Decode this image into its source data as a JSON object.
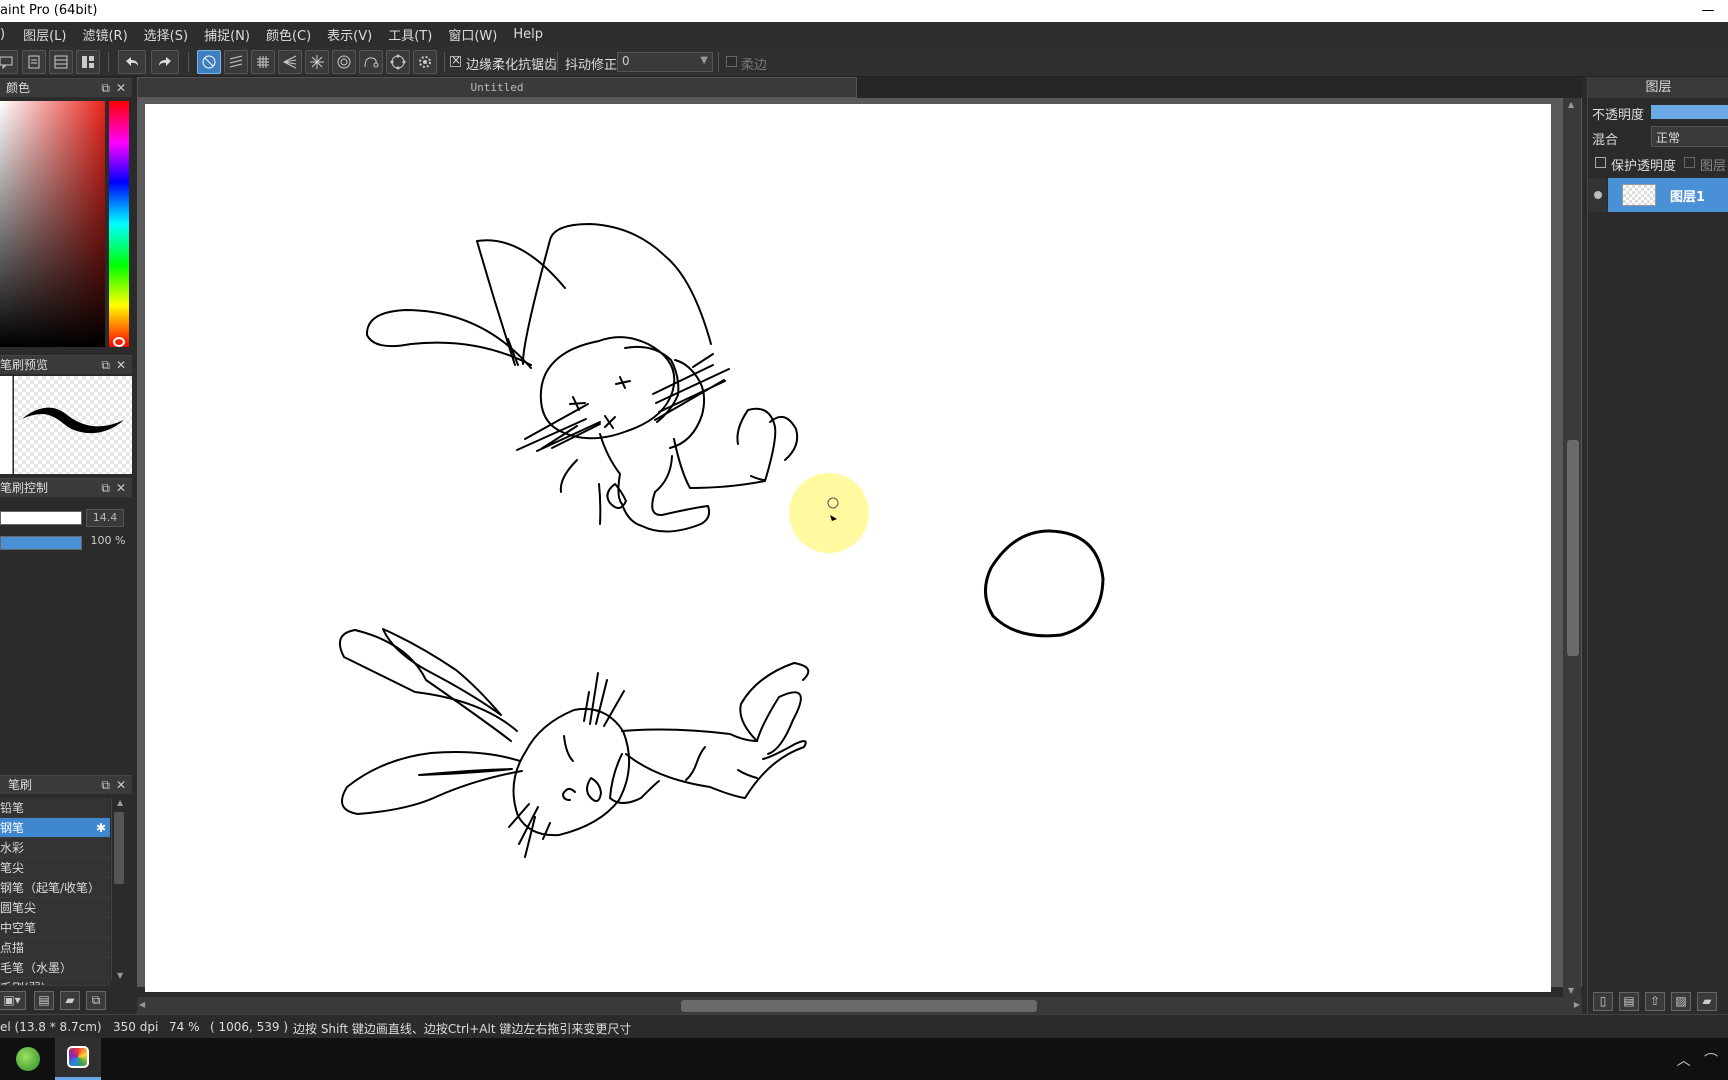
{
  "window": {
    "title": "aint Pro (64bit)"
  },
  "menu": [
    ")",
    "图层(L)",
    "滤镜(R)",
    "选择(S)",
    "捕捉(N)",
    "颜色(C)",
    "表示(V)",
    "工具(T)",
    "窗口(W)",
    "Help"
  ],
  "toolbar": {
    "antialias_label": "边缘柔化抗锯齿",
    "stabilizer_label": "抖动修正",
    "stabilizer_value": "0",
    "soft_edge_label": "柔边"
  },
  "panels": {
    "color": {
      "title": "颜色"
    },
    "brush_preview": {
      "title": "笔刷预览"
    },
    "brush_control": {
      "title": "笔刷控制",
      "size_value": "14.4",
      "opacity_value": "100 %"
    },
    "brush": {
      "title": "笔刷",
      "items": [
        "铅笔",
        "钢笔",
        "水彩",
        "笔尖",
        "钢笔（起笔/收笔）",
        "圆笔尖",
        "中空笔",
        "点描",
        "毛笔（水墨）",
        "毛刷(弱)"
      ],
      "selected_index": 1
    }
  },
  "document": {
    "tab_title": "Untitled"
  },
  "layers": {
    "title": "图层",
    "opacity_label": "不透明度",
    "blend_label": "混合",
    "blend_value": "正常",
    "protect_alpha_label": "保护透明度",
    "clip_label": "图层剪",
    "items": [
      {
        "name": "图层1"
      }
    ]
  },
  "status": {
    "size": "el  (13.8 * 8.7cm)",
    "dpi": "350 dpi",
    "zoom": "74 %",
    "coords": "( 1006, 539 )",
    "hint": "边按 Shift 键边画直线、边按Ctrl+Alt 键边左右拖引来变更尺寸"
  },
  "colors": {
    "accent": "#3f88cf",
    "layer_selected": "#4a90d6",
    "panel_bg": "#2b2b2b",
    "canvas_bg": "#ffffff",
    "cursor_highlight": "#fffa96"
  }
}
